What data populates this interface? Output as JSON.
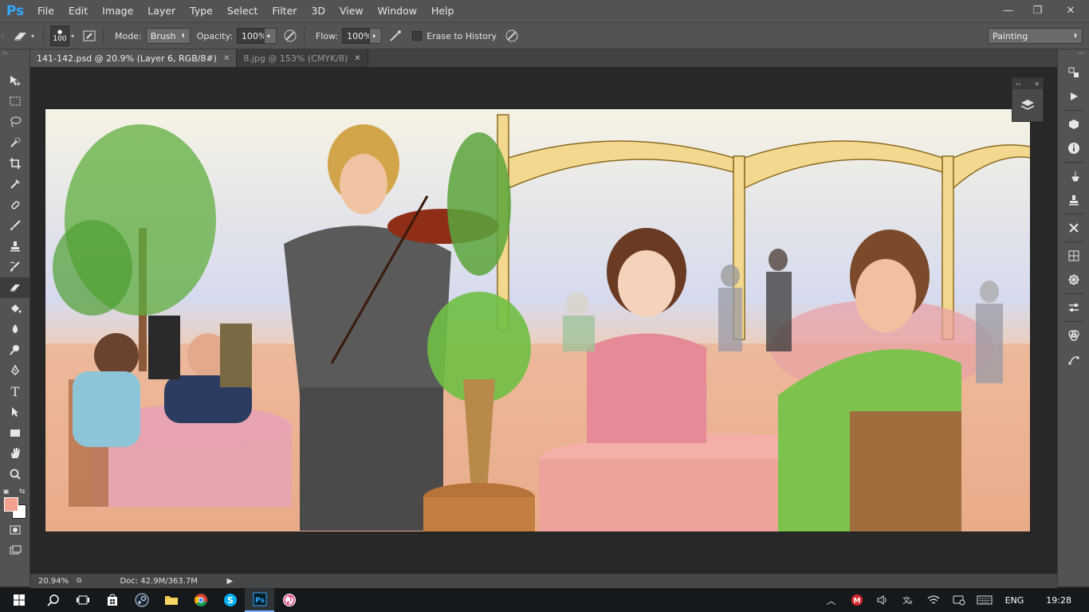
{
  "app": {
    "logo": "Ps",
    "menu": [
      "File",
      "Edit",
      "Image",
      "Layer",
      "Type",
      "Select",
      "Filter",
      "3D",
      "View",
      "Window",
      "Help"
    ],
    "window_controls": {
      "minimize": "—",
      "restore": "❐",
      "close": "✕"
    }
  },
  "options_bar": {
    "brush_size": "100",
    "mode_label": "Mode:",
    "mode_value": "Brush",
    "opacity_label": "Opacity:",
    "opacity_value": "100%",
    "flow_label": "Flow:",
    "flow_value": "100%",
    "erase_history_label": "Erase to History",
    "erase_history_checked": false,
    "workspace": "Painting"
  },
  "tabs": [
    {
      "label": "141-142.psd @ 20.9% (Layer 6, RGB/8#)",
      "active": true
    },
    {
      "label": "8.jpg @ 153% (CMYK/8)",
      "active": false
    }
  ],
  "tools": [
    "move-icon",
    "marquee-icon",
    "lasso-icon",
    "quick-select-icon",
    "crop-icon",
    "eyedropper-icon",
    "healing-icon",
    "brush-icon",
    "stamp-icon",
    "history-brush-icon",
    "eraser-icon",
    "gradient-icon",
    "blur-icon",
    "dodge-icon",
    "pen-icon",
    "type-icon",
    "path-select-icon",
    "rectangle-icon",
    "hand-icon",
    "zoom-icon"
  ],
  "colors": {
    "foreground": "#f2a08f",
    "background": "#ffffff",
    "ps_blue": "#31a8ff"
  },
  "status": {
    "zoom": "20.94%",
    "doc": "Doc: 42.9M/363.7M"
  },
  "taskbar": {
    "apps": [
      "windows-icon",
      "search-icon",
      "task-view-icon",
      "store-icon",
      "steam-icon",
      "file-explorer-icon",
      "chrome-icon",
      "skype-icon",
      "photoshop-icon",
      "itunes-icon"
    ],
    "language": "ENG",
    "time": "19:28"
  }
}
